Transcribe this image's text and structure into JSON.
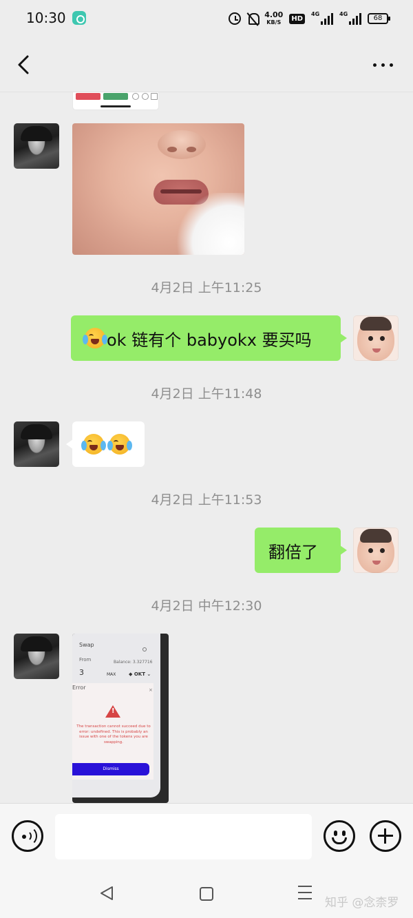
{
  "status_bar": {
    "time": "10:30",
    "net_speed_value": "4.00",
    "net_speed_unit": "KB/S",
    "hd_badge": "HD",
    "signal_1": "4G",
    "signal_2": "4G",
    "battery": "68"
  },
  "header": {
    "back_icon": "chevron-left-icon",
    "more_icon": "more-horizontal-icon"
  },
  "messages": [
    {
      "type": "image",
      "side": "left",
      "image": "cropped-screenshot-with-red-green-buttons"
    },
    {
      "type": "image",
      "side": "left",
      "image": "baby-face-closeup"
    },
    {
      "type": "timestamp",
      "text": "4月2日 上午11:25"
    },
    {
      "type": "text",
      "side": "right",
      "emoji": "loudly-crying-face",
      "text": "ok 链有个 babyokx 要买吗"
    },
    {
      "type": "timestamp",
      "text": "4月2日 上午11:48"
    },
    {
      "type": "emoji",
      "side": "left",
      "emojis": [
        "loudly-crying-face",
        "loudly-crying-face"
      ]
    },
    {
      "type": "timestamp",
      "text": "4月2日 上午11:53"
    },
    {
      "type": "text",
      "side": "right",
      "text": "翻倍了"
    },
    {
      "type": "timestamp",
      "text": "4月2日 中午12:30"
    },
    {
      "type": "image",
      "side": "left",
      "image": "swap-error-phone-screenshot"
    }
  ],
  "swap_screenshot": {
    "title": "Swap",
    "from_label": "From",
    "balance": "Balance: 3.327716",
    "amount": "3",
    "max_label": "MAX",
    "token": "◆ OKT ⌄",
    "error_title": "Error",
    "close": "×",
    "error_message": "The transaction cannot succeed due to error: undefined. This is probably an issue with one of the tokens you are swapping.",
    "dismiss_label": "Dismiss"
  },
  "input_bar": {
    "voice_icon": "voice-input-icon",
    "placeholder": "",
    "emoji_icon": "smiley-face-icon",
    "plus_icon": "plus-circle-icon"
  },
  "nav_bar": {
    "back_icon": "triangle-back-icon",
    "home_icon": "square-home-icon",
    "menu_icon": "three-line-menu-icon"
  },
  "watermark": "知乎 @念柰罗"
}
